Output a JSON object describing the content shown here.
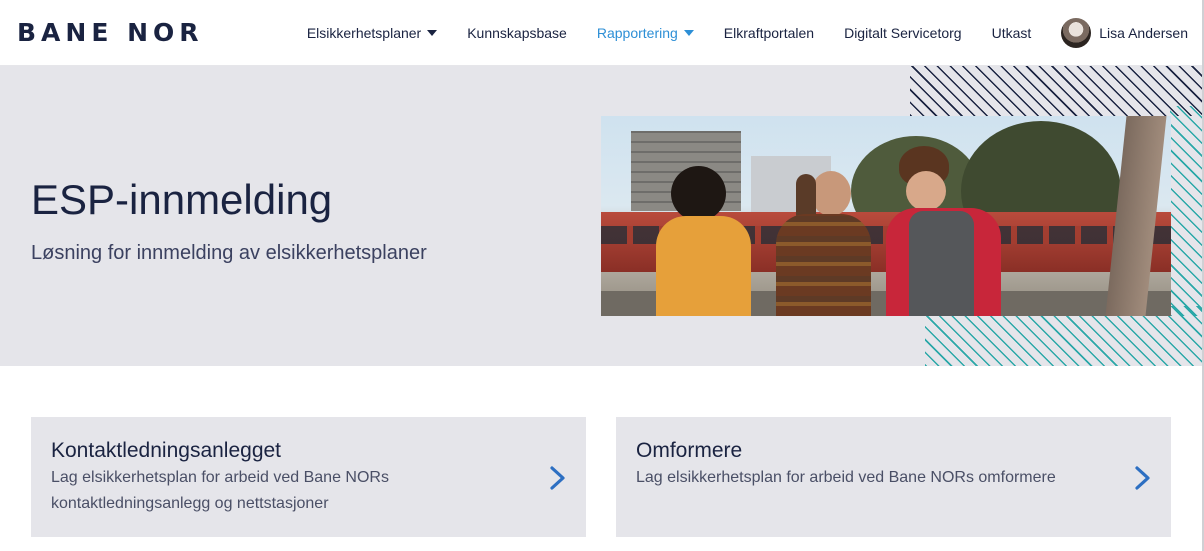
{
  "brand": {
    "logo_text": "BANE NOR"
  },
  "nav": {
    "items": [
      {
        "label": "Elsikkerhetsplaner",
        "has_dropdown": true,
        "active": false
      },
      {
        "label": "Kunnskapsbase",
        "has_dropdown": false,
        "active": false
      },
      {
        "label": "Rapportering",
        "has_dropdown": true,
        "active": true
      },
      {
        "label": "Elkraftportalen",
        "has_dropdown": false,
        "active": false
      },
      {
        "label": "Digitalt Servicetorg",
        "has_dropdown": false,
        "active": false
      },
      {
        "label": "Utkast",
        "has_dropdown": false,
        "active": false
      }
    ],
    "user": {
      "name": "Lisa Andersen"
    }
  },
  "hero": {
    "title": "ESP-innmelding",
    "subtitle": "Løsning for innmelding av elsikkerhetsplaner"
  },
  "cards": [
    {
      "title": "Kontaktledningsanlegget",
      "description": "Lag elsikkerhetsplan for arbeid ved Bane NORs kontaktledningsanlegg og nettstasjoner"
    },
    {
      "title": "Omformere",
      "description": "Lag elsikkerhetsplan for arbeid ved Bane NORs omformere"
    }
  ],
  "colors": {
    "brand_navy": "#1a2341",
    "accent_blue": "#2d8fd6",
    "teal_stripe": "#2aa8a8",
    "hero_bg": "#e5e5ea"
  }
}
